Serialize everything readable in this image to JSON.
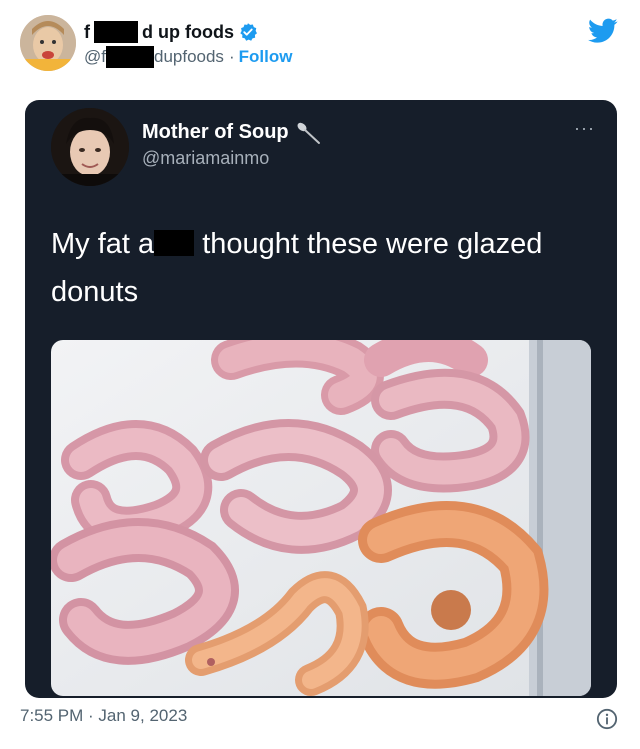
{
  "outer": {
    "name_tail": "d up foods",
    "handle_tail": "dupfoods",
    "handle_prefix": "@f",
    "follow_label": "Follow",
    "separator": "·",
    "timestamp": "7:55 PM · Jan 9, 2023"
  },
  "inner": {
    "name": "Mother of Soup",
    "handle": "@mariamainmo",
    "more_label": "···",
    "text_before": "My fat a",
    "text_after": "thought these were glazed donuts"
  },
  "colors": {
    "twitter_blue": "#1d9bf0",
    "card_bg": "#161e2a",
    "muted_text": "#536471"
  },
  "icons": [
    "twitter-bird-icon",
    "verified-badge-icon",
    "spoon-icon",
    "more-icon",
    "info-icon"
  ]
}
